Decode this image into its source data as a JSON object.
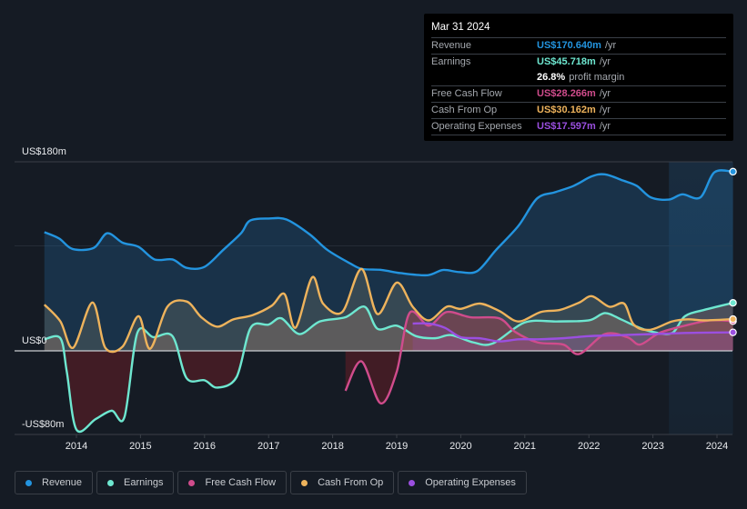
{
  "chart_data": {
    "type": "line",
    "title": "",
    "xlabel": "",
    "ylabel": "",
    "y_tick_labels": [
      "US$180m",
      "US$0",
      "-US$80m"
    ],
    "ylim": [
      -80,
      180
    ],
    "xlim": [
      2013.5,
      2024.25
    ],
    "x_ticks": [
      "2014",
      "2015",
      "2016",
      "2017",
      "2018",
      "2019",
      "2020",
      "2021",
      "2022",
      "2023",
      "2024"
    ],
    "highlight_region": [
      2023.25,
      2024.25
    ],
    "legend_position": "bottom-left",
    "series": [
      {
        "name": "Revenue",
        "color": "#2394df",
        "x": [
          2013.5,
          2013.73,
          2013.94,
          2014.27,
          2014.48,
          2014.72,
          2014.97,
          2015.22,
          2015.5,
          2015.72,
          2016.0,
          2016.29,
          2016.57,
          2016.71,
          2017.0,
          2017.28,
          2017.64,
          2017.92,
          2018.28,
          2018.46,
          2018.77,
          2019.06,
          2019.48,
          2019.72,
          2019.98,
          2020.26,
          2020.55,
          2020.9,
          2021.19,
          2021.47,
          2021.76,
          2022.04,
          2022.25,
          2022.54,
          2022.75,
          2022.97,
          2023.25,
          2023.46,
          2023.74,
          2023.96,
          2024.25
        ],
        "values": [
          113,
          107,
          97,
          98,
          112,
          103,
          99,
          87,
          87,
          79,
          80,
          96,
          112,
          124,
          126,
          125,
          111,
          96,
          83,
          78,
          77,
          74,
          72,
          77,
          75,
          76,
          96,
          119,
          145,
          151,
          157,
          166,
          168,
          162,
          157,
          146,
          144,
          149,
          146,
          170,
          170.6
        ]
      },
      {
        "name": "Earnings",
        "color": "#6ee7d0",
        "x": [
          2013.5,
          2013.75,
          2013.85,
          2014.0,
          2014.3,
          2014.55,
          2014.75,
          2014.95,
          2015.2,
          2015.5,
          2015.72,
          2016.0,
          2016.2,
          2016.5,
          2016.72,
          2017.0,
          2017.2,
          2017.48,
          2017.8,
          2018.2,
          2018.5,
          2018.7,
          2019.0,
          2019.3,
          2019.6,
          2019.85,
          2020.2,
          2020.5,
          2021.0,
          2021.5,
          2022.0,
          2022.25,
          2022.5,
          2022.75,
          2023.0,
          2023.3,
          2023.5,
          2023.8,
          2024.25
        ],
        "values": [
          11,
          12,
          -20,
          -75,
          -65,
          -57,
          -63,
          17,
          13,
          14,
          -26,
          -28,
          -35,
          -25,
          22,
          25,
          31,
          16,
          28,
          32,
          42,
          21,
          24,
          14,
          12,
          15,
          8,
          7,
          27,
          28,
          29,
          36,
          30,
          23,
          18,
          17,
          33,
          39,
          45.7
        ]
      },
      {
        "name": "Free Cash Flow",
        "color": "#d04c8c",
        "x": [
          2018.2,
          2018.45,
          2018.75,
          2019.0,
          2019.2,
          2019.5,
          2019.78,
          2020.15,
          2020.6,
          2020.85,
          2021.2,
          2021.6,
          2021.85,
          2022.25,
          2022.6,
          2022.8,
          2023.1,
          2023.5,
          2023.9,
          2024.25
        ],
        "values": [
          -38,
          -10,
          -50,
          -20,
          36,
          24,
          37,
          32,
          31,
          18,
          8,
          6,
          -3,
          16,
          13,
          6,
          17,
          24,
          29,
          28.3
        ]
      },
      {
        "name": "Cash From Op",
        "color": "#eeb35c",
        "x": [
          2013.5,
          2013.75,
          2013.95,
          2014.25,
          2014.45,
          2014.72,
          2014.97,
          2015.15,
          2015.42,
          2015.72,
          2015.95,
          2016.2,
          2016.45,
          2016.75,
          2017.05,
          2017.25,
          2017.42,
          2017.68,
          2017.85,
          2018.15,
          2018.45,
          2018.7,
          2019.0,
          2019.25,
          2019.5,
          2019.78,
          2020.0,
          2020.3,
          2020.6,
          2020.9,
          2021.25,
          2021.55,
          2021.85,
          2022.05,
          2022.32,
          2022.55,
          2022.7,
          2022.95,
          2023.3,
          2023.55,
          2023.8,
          2024.25
        ],
        "values": [
          44,
          28,
          3,
          46,
          3,
          4,
          33,
          2,
          42,
          47,
          32,
          23,
          30,
          34,
          43,
          54,
          22,
          70,
          45,
          37,
          78,
          35,
          65,
          42,
          29,
          42,
          40,
          45,
          38,
          28,
          37,
          39,
          46,
          52,
          42,
          45,
          25,
          20,
          28,
          30,
          29,
          30.2
        ]
      },
      {
        "name": "Operating Expenses",
        "color": "#9b4fe0",
        "x": [
          2019.25,
          2019.5,
          2019.75,
          2020.0,
          2020.3,
          2020.6,
          2020.9,
          2021.2,
          2021.6,
          2022.0,
          2022.5,
          2023.0,
          2023.5,
          2024.0,
          2024.25
        ],
        "values": [
          26,
          26,
          22,
          13,
          12,
          9,
          11,
          11,
          12,
          14,
          15,
          16,
          17,
          17.5,
          17.6
        ]
      }
    ]
  },
  "tooltip": {
    "date": "Mar 31 2024",
    "rows": [
      {
        "label": "Revenue",
        "value": "US$170.640m",
        "unit": "/yr",
        "color": "#2394df"
      },
      {
        "label": "Earnings",
        "value": "US$45.718m",
        "unit": "/yr",
        "color": "#6ee7d0"
      },
      {
        "label": "",
        "value": "26.8%",
        "unit": "profit margin",
        "color": "#ffffff"
      },
      {
        "label": "Free Cash Flow",
        "value": "US$28.266m",
        "unit": "/yr",
        "color": "#d04c8c"
      },
      {
        "label": "Cash From Op",
        "value": "US$30.162m",
        "unit": "/yr",
        "color": "#eeb35c"
      },
      {
        "label": "Operating Expenses",
        "value": "US$17.597m",
        "unit": "/yr",
        "color": "#9b4fe0"
      }
    ]
  },
  "legend": [
    {
      "label": "Revenue",
      "color": "#2394df"
    },
    {
      "label": "Earnings",
      "color": "#6ee7d0"
    },
    {
      "label": "Free Cash Flow",
      "color": "#d04c8c"
    },
    {
      "label": "Cash From Op",
      "color": "#eeb35c"
    },
    {
      "label": "Operating Expenses",
      "color": "#9b4fe0"
    }
  ]
}
